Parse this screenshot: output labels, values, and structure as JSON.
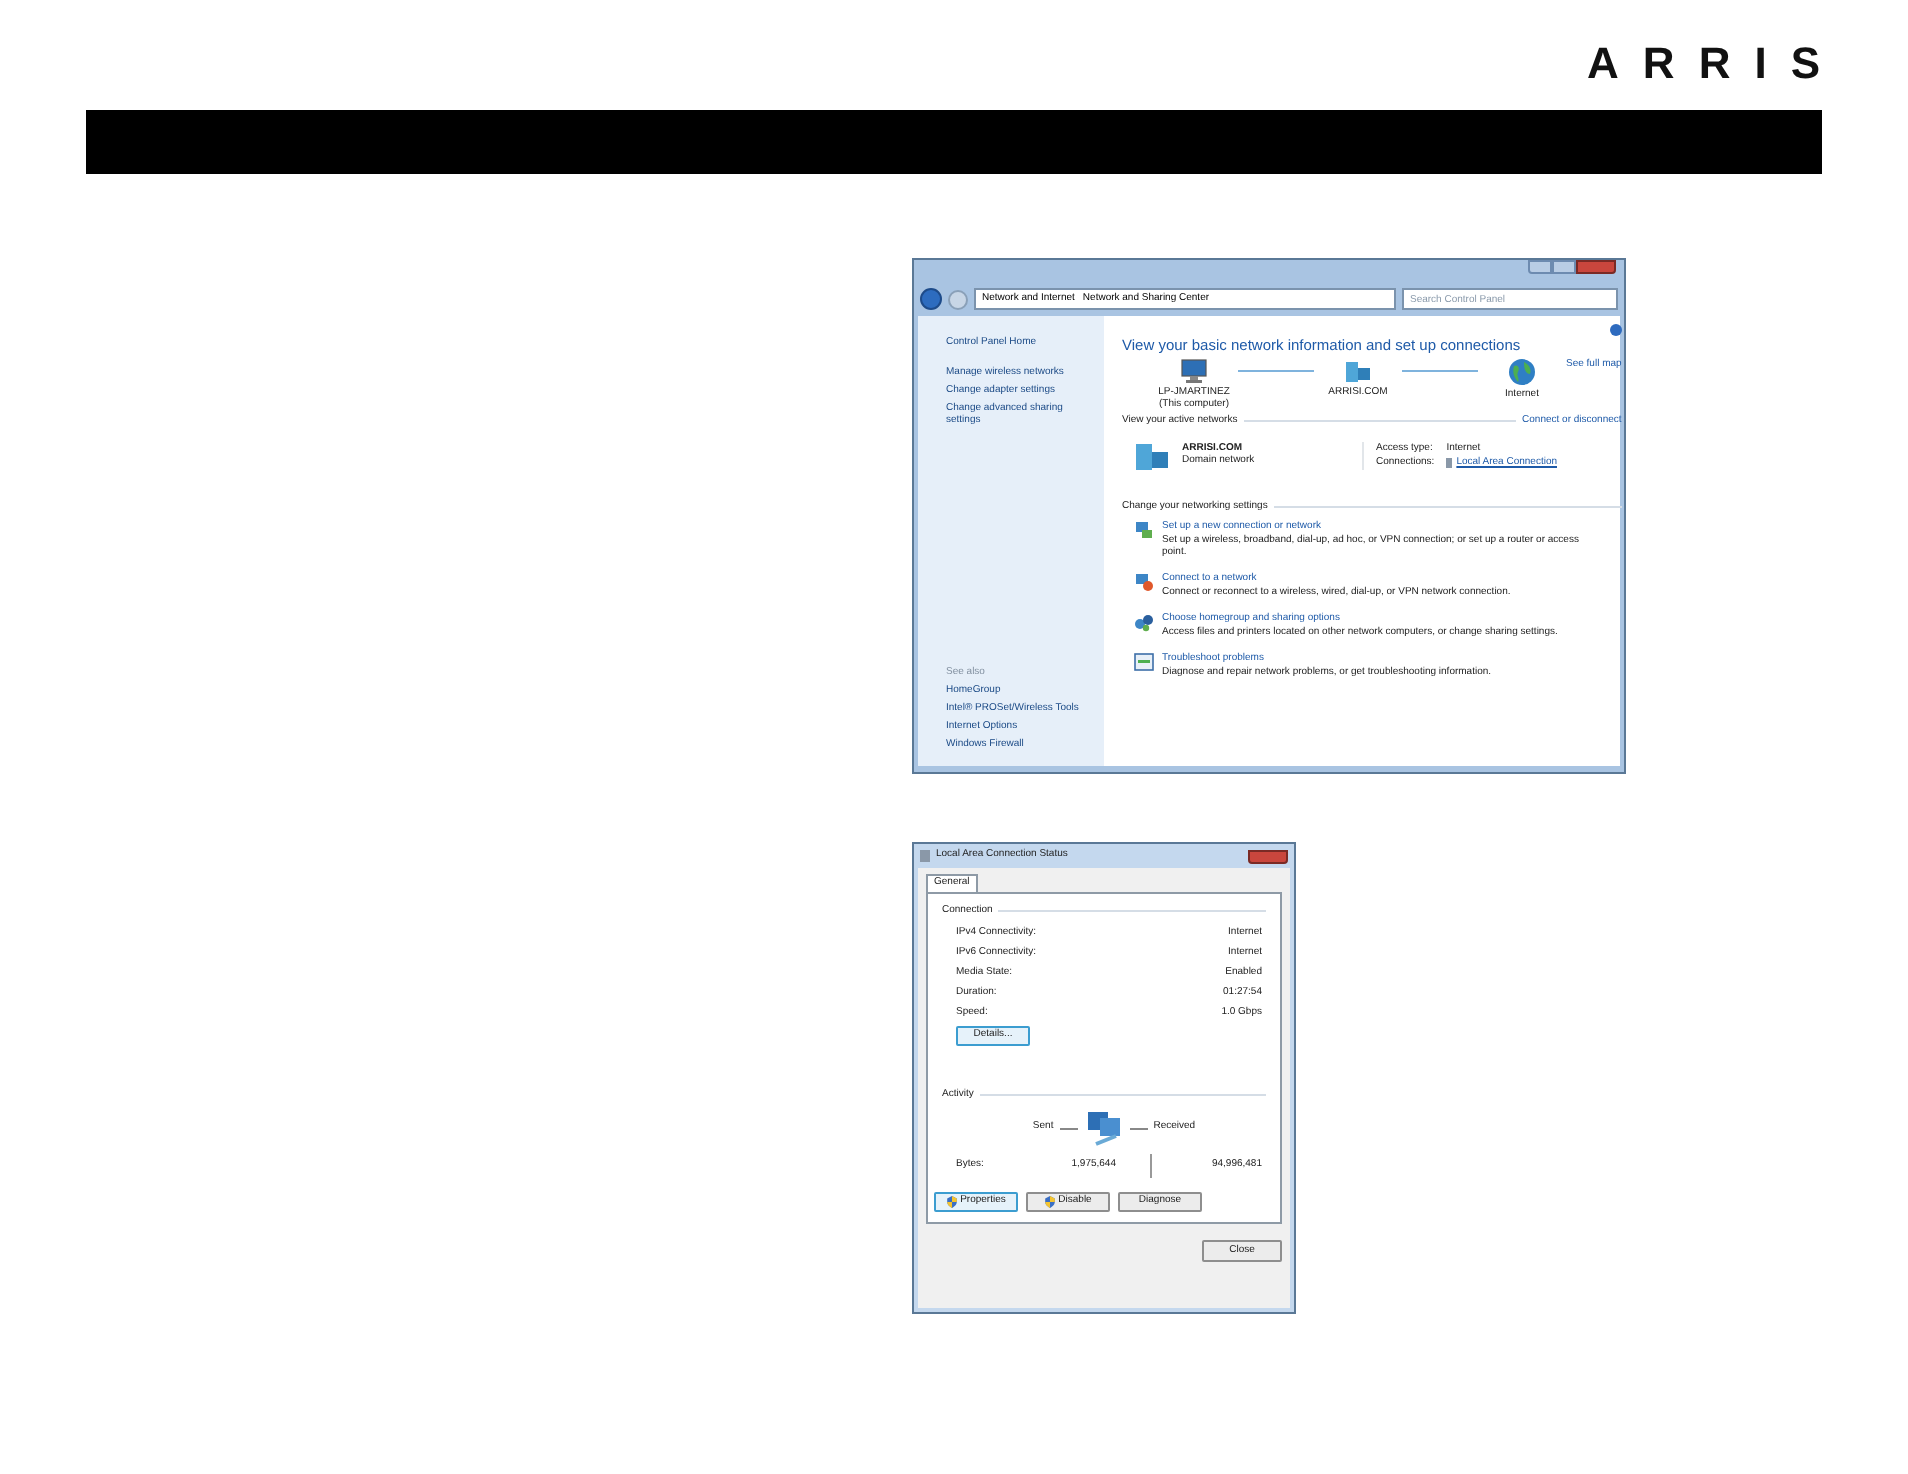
{
  "logo": "ARRIS",
  "network_window": {
    "breadcrumb": [
      "Network and Internet",
      "Network and Sharing Center"
    ],
    "search": {
      "placeholder": "Search Control Panel"
    },
    "sidebar": {
      "items": [
        "Control Panel Home",
        "Manage wireless networks",
        "Change adapter settings",
        "Change advanced sharing settings"
      ],
      "see_also_heading": "See also",
      "see_also": [
        "HomeGroup",
        "Intel® PROSet/Wireless Tools",
        "Internet Options",
        "Windows Firewall"
      ]
    },
    "heading": "View your basic network information and set up connections",
    "see_full_map": "See full map",
    "map_nodes": [
      {
        "kind": "computer",
        "name": "LP-JMARTINEZ",
        "sub": "(This computer)"
      },
      {
        "kind": "network",
        "name": "ARRISI.COM"
      },
      {
        "kind": "globe",
        "name": "Internet"
      }
    ],
    "active_networks_heading": "View your active networks",
    "connect_link": "Connect or disconnect",
    "active_network": {
      "name": "ARRISI.COM",
      "type": "Domain network",
      "access_type_label": "Access type:",
      "access_type": "Internet",
      "connections_label": "Connections:",
      "connection": "Local Area Connection"
    },
    "settings_heading": "Change your networking settings",
    "tasks": [
      {
        "kind": "setup",
        "title": "Set up a new connection or network",
        "description": "Set up a wireless, broadband, dial-up, ad hoc, or VPN connection; or set up a router or access point."
      },
      {
        "kind": "connect",
        "title": "Connect to a network",
        "description": "Connect or reconnect to a wireless, wired, dial-up, or VPN network connection."
      },
      {
        "kind": "homegroup",
        "title": "Choose homegroup and sharing options",
        "description": "Access files and printers located on other network computers, or change sharing settings."
      },
      {
        "kind": "troubleshoot",
        "title": "Troubleshoot problems",
        "description": "Diagnose and repair network problems, or get troubleshooting information."
      }
    ]
  },
  "status_window": {
    "title": "Local Area Connection Status",
    "tabs": [
      {
        "label": "General",
        "selected": true
      }
    ],
    "connection_heading": "Connection",
    "rows": [
      {
        "label": "IPv4 Connectivity:",
        "value": "Internet"
      },
      {
        "label": "IPv6 Connectivity:",
        "value": "Internet"
      },
      {
        "label": "Media State:",
        "value": "Enabled"
      },
      {
        "label": "Duration:",
        "value": "01:27:54"
      },
      {
        "label": "Speed:",
        "value": "1.0 Gbps"
      }
    ],
    "details_button": "Details...",
    "activity_heading": "Activity",
    "sent_label": "Sent",
    "received_label": "Received",
    "bytes_label": "Bytes:",
    "bytes_sent": "1,975,644",
    "bytes_received": "94,996,481",
    "buttons": [
      {
        "label": "Properties",
        "shield": true,
        "selected": true
      },
      {
        "label": "Disable",
        "shield": true,
        "selected": false
      },
      {
        "label": "Diagnose",
        "shield": false,
        "selected": false
      }
    ],
    "close_button": "Close"
  }
}
